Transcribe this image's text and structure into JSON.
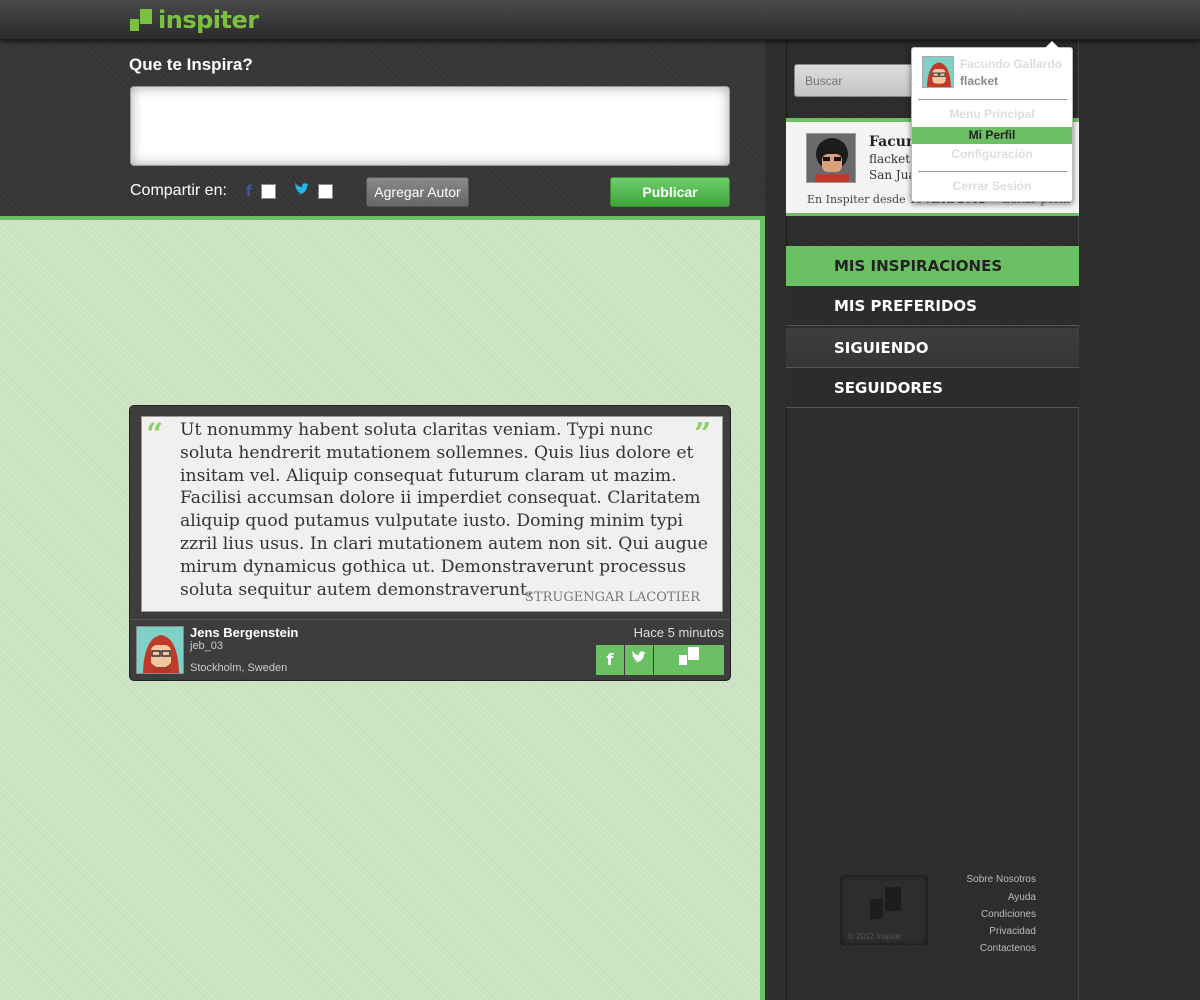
{
  "header": {
    "logo_text": "inspiter",
    "brand_color": "#7bc043"
  },
  "compose": {
    "title": "Que te Inspira?",
    "placeholder": "",
    "share_label": "Compartir en:",
    "facebook_icon": "f",
    "twitter_icon": "t",
    "add_author_label": "Agregar Autor",
    "publish_label": "Publicar"
  },
  "post": {
    "quote_open": "“",
    "quote_close": "”",
    "text": "Ut nonummy habent soluta claritas veniam. Typi nunc soluta hendrerit mutationem sollemnes. Quis lius dolore et insitam vel. Aliquip consequat futurum claram ut mazim. Facilisi accumsan dolore ii imperdiet consequat. Claritatem aliquip quod putamus vulputate iusto. Doming minim typi zzril lius usus. In clari mutationem autem non sit. Qui augue mirum dynamicus gothica ut. Demonstraverunt processus soluta sequitur autem demonstraverunt.",
    "author": "STRUGENGAR LACOTIER",
    "user_name": "Jens Bergenstein",
    "user_handle": "jeb_03",
    "user_location": "Stockholm, Sweden",
    "time": "Hace 5 minutos",
    "share_fb": "f",
    "share_tw": "t"
  },
  "search": {
    "placeholder": "Buscar"
  },
  "profile": {
    "name": "Facundo",
    "handle": "flacket",
    "location": "San Juan",
    "since": "En Inspiter desde 19 Abril 2012",
    "edit": "Editar perfil"
  },
  "nav": {
    "items": [
      {
        "label": "MIS INSPIRACIONES"
      },
      {
        "label": "MIS PREFERIDOS"
      },
      {
        "label": "SIGUIENDO"
      },
      {
        "label": "SEGUIDORES"
      }
    ]
  },
  "footer": {
    "copyright": "© 2012 Inspiter",
    "links": [
      "Sobre Nosotros",
      "Ayuda",
      "Condiciones",
      "Privacidad",
      "Contactenos"
    ]
  },
  "dropdown": {
    "name": "Facundo Gallardo",
    "handle": "flacket",
    "items": [
      "Menu Principal",
      "Mi Perfil",
      "Configuración",
      "Cerrar Sesión"
    ]
  },
  "colors": {
    "accent": "#6bc063",
    "feed_bg": "#cfe6c7"
  }
}
